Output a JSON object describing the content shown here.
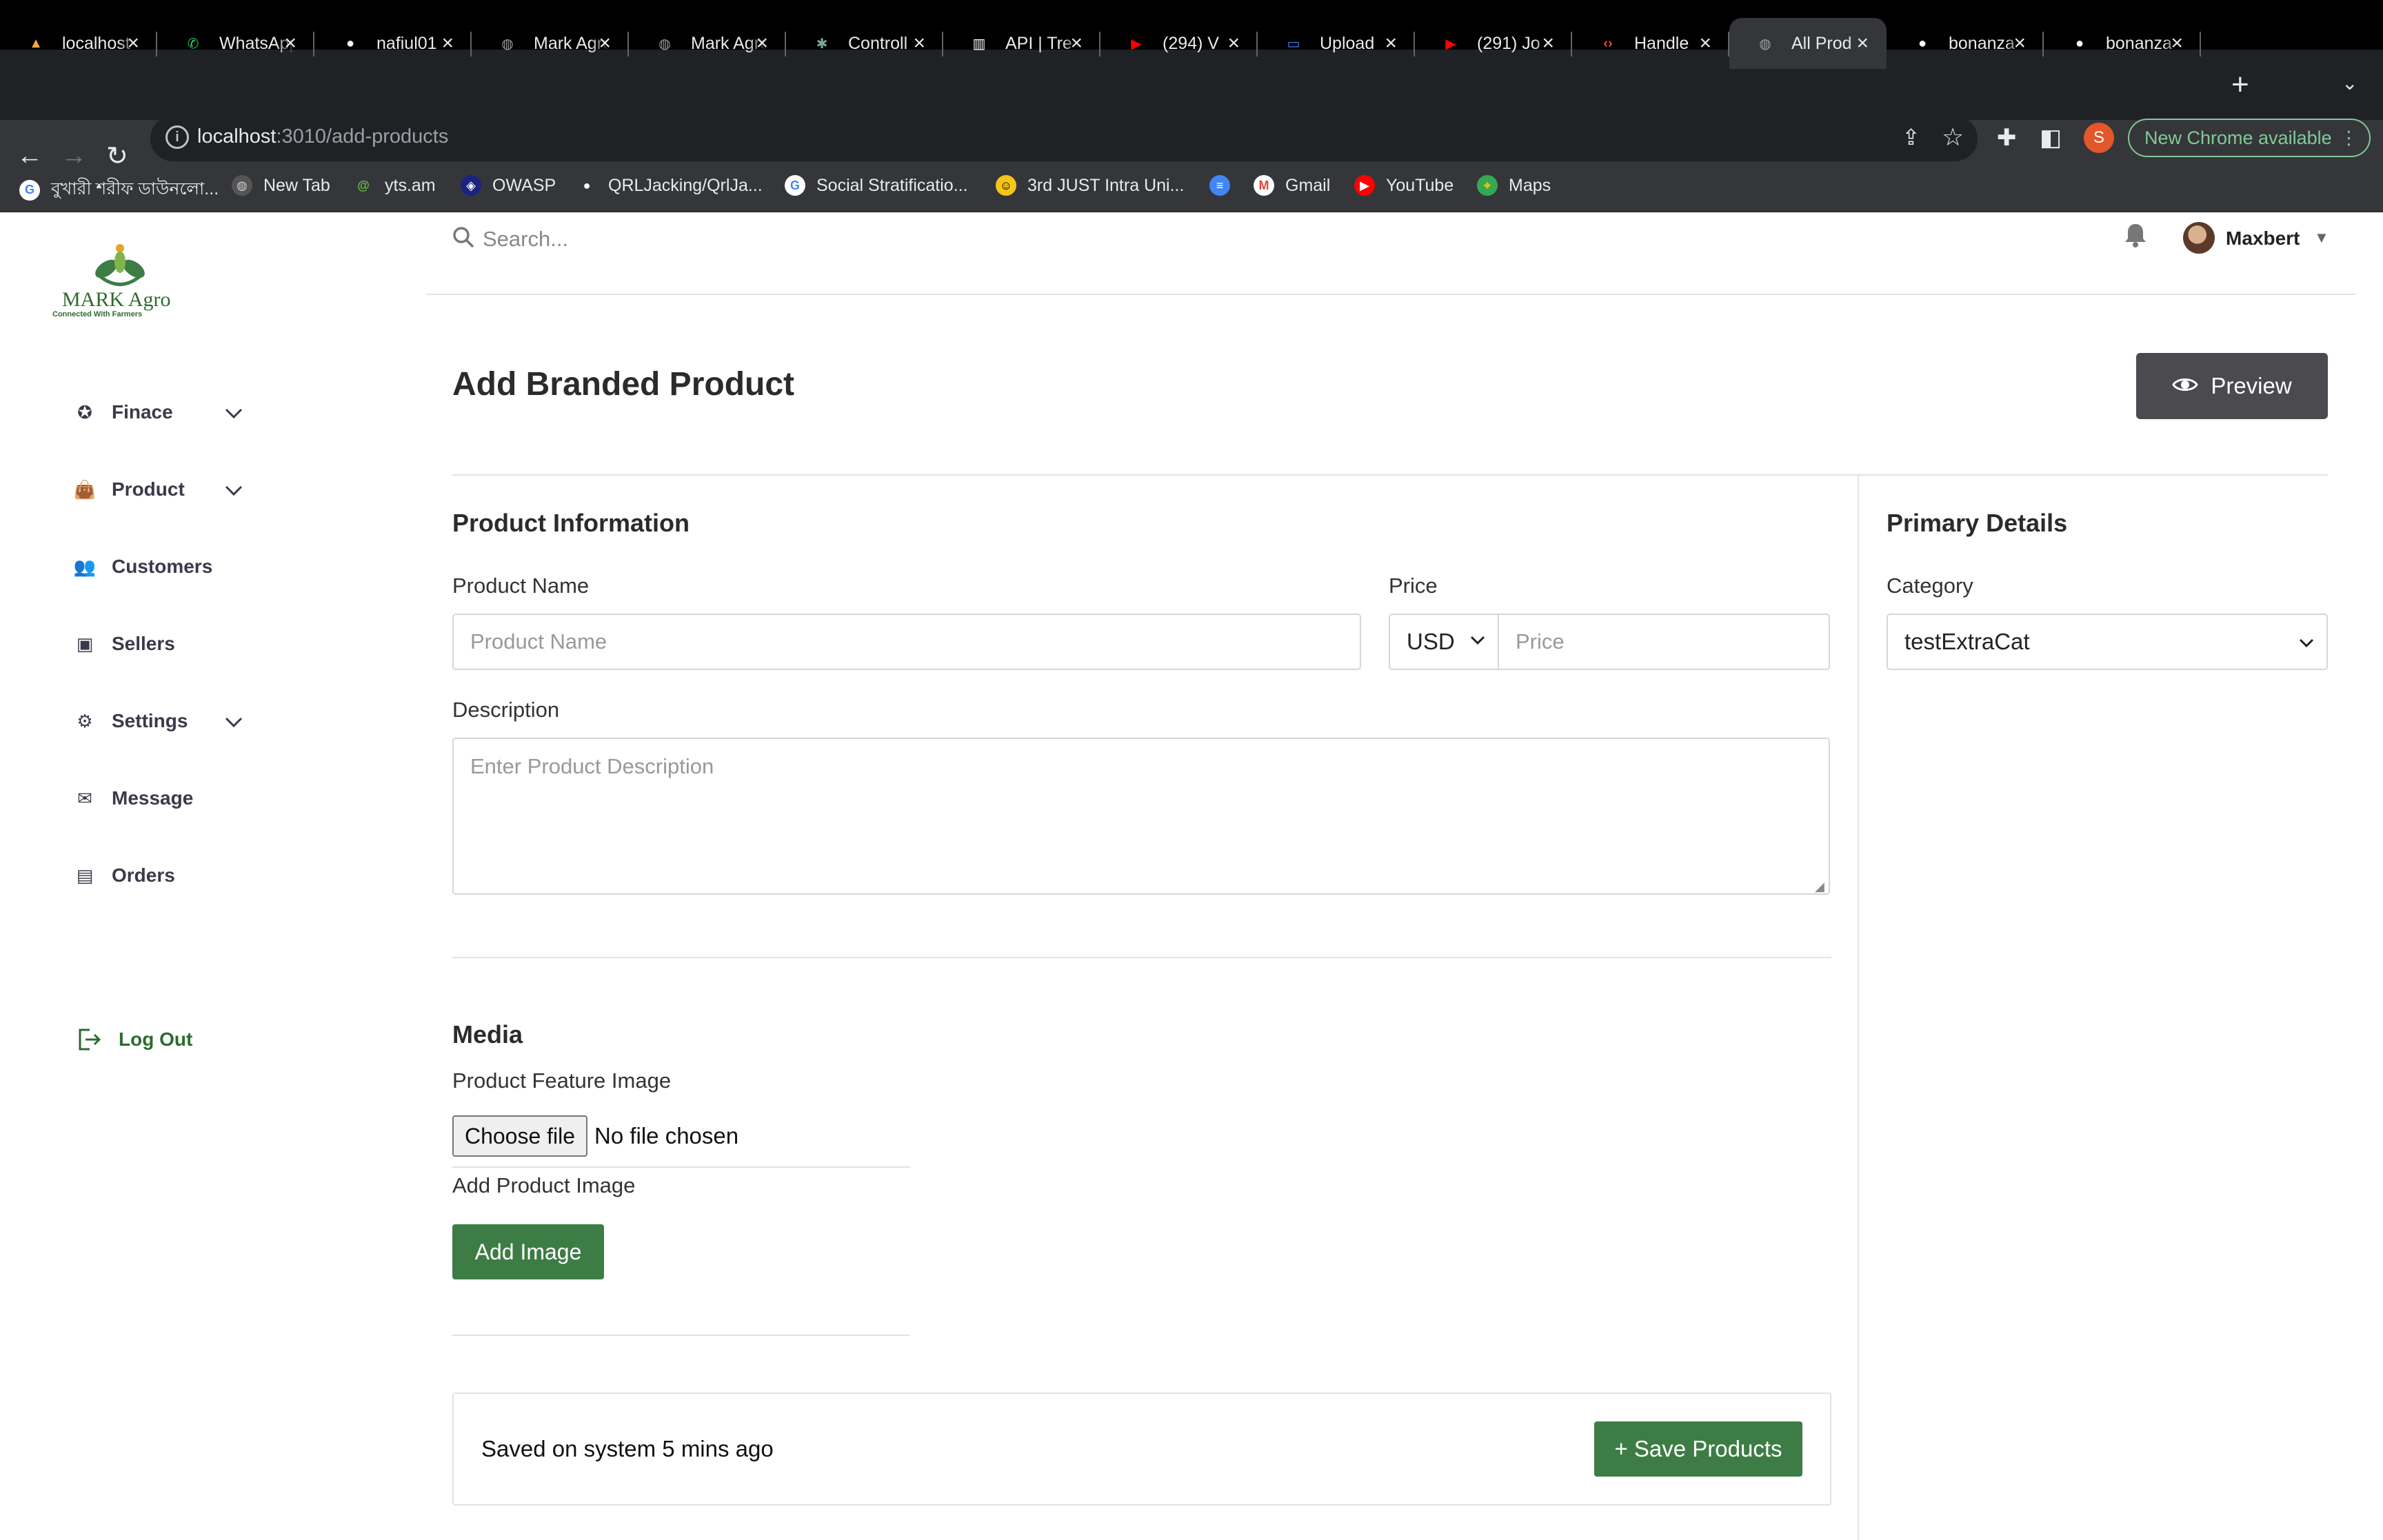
{
  "browser": {
    "tabs": [
      {
        "title": "localhost",
        "icon": "tab-favicon-localhost"
      },
      {
        "title": "WhatsApp",
        "icon": "whatsapp-icon"
      },
      {
        "title": "nafiul01",
        "icon": "github-icon"
      },
      {
        "title": "Mark Agro",
        "icon": "globe-icon"
      },
      {
        "title": "Mark Agro",
        "icon": "globe-icon"
      },
      {
        "title": "Controll",
        "icon": "openai-icon"
      },
      {
        "title": "API | Tre",
        "icon": "trello-icon"
      },
      {
        "title": "(294) V",
        "icon": "youtube-icon"
      },
      {
        "title": "Upload",
        "icon": "laptop-icon"
      },
      {
        "title": "(291) Jo",
        "icon": "youtube-icon"
      },
      {
        "title": "Handle",
        "icon": "code-icon"
      },
      {
        "title": "All Prod",
        "icon": "globe-icon",
        "active": true
      },
      {
        "title": "bonanza",
        "icon": "github-icon"
      },
      {
        "title": "bonanza",
        "icon": "github-icon"
      }
    ],
    "url_host": "localhost",
    "url_path": ":3010/add-products",
    "profile_initial": "S",
    "update_label": "New Chrome available",
    "bookmarks": [
      {
        "label": "বুখারী শরীফ ডাউনলো...",
        "icon": "google-icon"
      },
      {
        "label": "New Tab",
        "icon": "globe-icon"
      },
      {
        "label": "yts.am",
        "icon": "yts-icon"
      },
      {
        "label": "OWASP",
        "icon": "owasp-icon"
      },
      {
        "label": "QRLJacking/QrlJa...",
        "icon": "github-icon"
      },
      {
        "label": "Social Stratificatio...",
        "icon": "google-icon"
      },
      {
        "label": "3rd JUST Intra Uni...",
        "icon": "emoji-icon"
      },
      {
        "label": "",
        "icon": "docs-icon"
      },
      {
        "label": "Gmail",
        "icon": "gmail-icon"
      },
      {
        "label": "YouTube",
        "icon": "youtube-icon"
      },
      {
        "label": "Maps",
        "icon": "maps-icon"
      }
    ]
  },
  "brand": {
    "name": "MARK Agro",
    "tagline": "Connected With Farmers",
    "color": "#2e6b2e"
  },
  "sidebar": {
    "items": [
      {
        "label": "Finace",
        "icon": "finance-icon",
        "expandable": true
      },
      {
        "label": "Product",
        "icon": "bag-icon",
        "expandable": true
      },
      {
        "label": "Customers",
        "icon": "users-icon",
        "expandable": false
      },
      {
        "label": "Sellers",
        "icon": "contact-book-icon",
        "expandable": false
      },
      {
        "label": "Settings",
        "icon": "gear-icon",
        "expandable": true
      },
      {
        "label": "Message",
        "icon": "message-icon",
        "expandable": false
      },
      {
        "label": "Orders",
        "icon": "list-icon",
        "expandable": false
      }
    ],
    "logout_label": "Log Out"
  },
  "header": {
    "search_placeholder": "Search...",
    "username": "Maxbert"
  },
  "page": {
    "title": "Add Branded Product",
    "preview_label": "Preview",
    "product_info": {
      "title": "Product Information",
      "name_label": "Product Name",
      "name_placeholder": "Product Name",
      "price_label": "Price",
      "currency": "USD",
      "price_placeholder": "Price",
      "description_label": "Description",
      "description_placeholder": "Enter Product Description"
    },
    "primary": {
      "title": "Primary Details",
      "category_label": "Category",
      "category_value": "testExtraCat"
    },
    "media": {
      "title": "Media",
      "feature_label": "Product Feature Image",
      "choose_file_label": "Choose file",
      "no_file_label": "No file chosen",
      "add_image_label": "Add Product Image",
      "add_image_button": "Add Image"
    },
    "footer": {
      "saved_text": "Saved on system 5 mins ago",
      "save_button": "+ Save Products"
    }
  },
  "colors": {
    "primary_green": "#3d7d45",
    "preview_dark": "#4a4a4f",
    "chrome_dark": "#202124"
  }
}
